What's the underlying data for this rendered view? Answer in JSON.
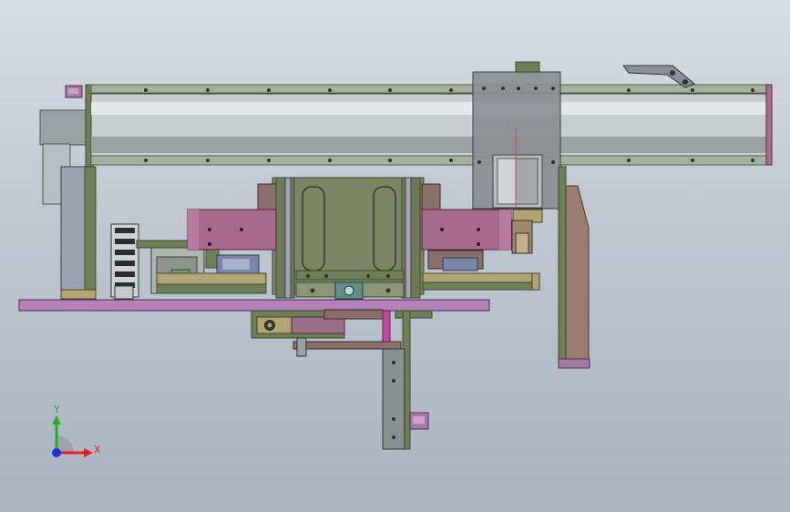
{
  "viewport": {
    "background_top": "#d9dde4",
    "background_bottom": "#aab3c1"
  },
  "triad": {
    "x_label": "X",
    "y_label": "Y",
    "x_color": "#e02020",
    "y_color": "#20b020",
    "z_color": "#2030e0"
  },
  "palette": {
    "rail": "#a7adb0",
    "rail_edge": "#6e8064",
    "plate_purple": "#a878a8",
    "frame_green": "#6f7f55",
    "block_pink": "#b06a8a",
    "carriage": "#8c8f92",
    "brown_arm": "#9a7d6e",
    "base_plate": "#b482b8"
  }
}
